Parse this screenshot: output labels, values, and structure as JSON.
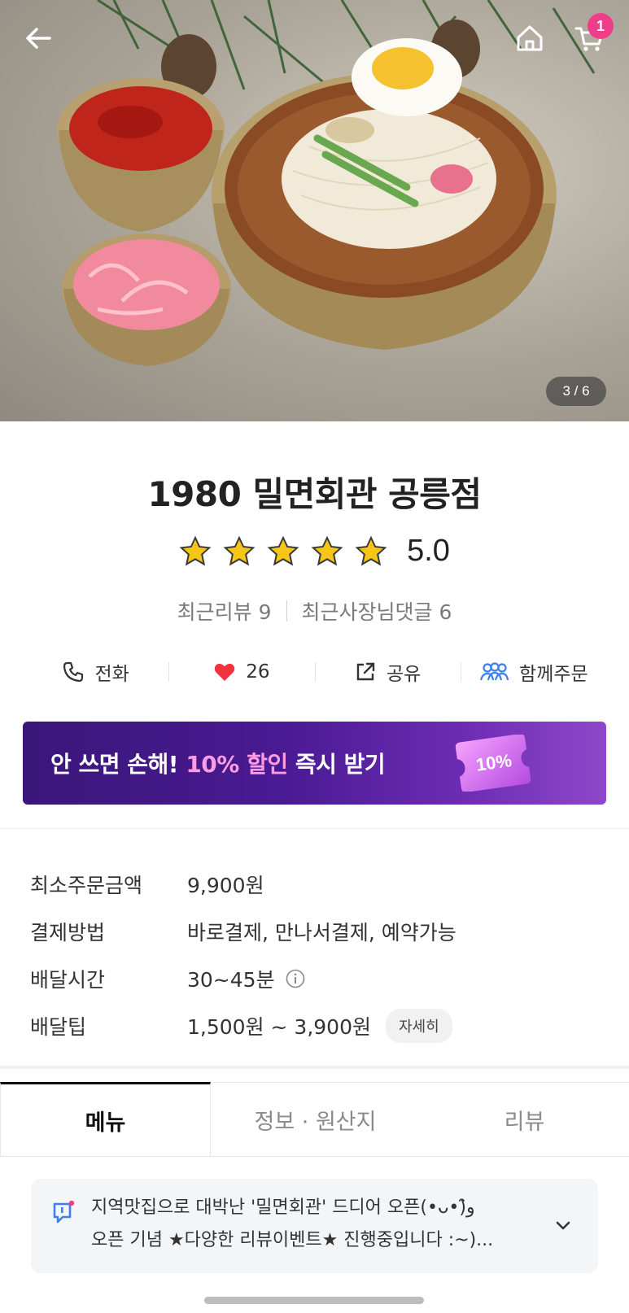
{
  "header": {
    "cart_count": "1",
    "image_pager": "3 / 6"
  },
  "store": {
    "name": "1980 밀면회관 공릉점",
    "rating": "5.0",
    "stars": 5,
    "recent_reviews": "최근리뷰 9",
    "owner_replies": "최근사장님댓글 6"
  },
  "actions": {
    "call": "전화",
    "likes": "26",
    "share": "공유",
    "group_order": "함께주문"
  },
  "banner": {
    "prefix": "안 쓰면 손해! ",
    "highlight": "10% 할인",
    "suffix": " 즉시 받기",
    "ticket": "10%"
  },
  "info": {
    "min_order_label": "최소주문금액",
    "min_order_value": "9,900원",
    "payment_label": "결제방법",
    "payment_value": "바로결제, 만나서결제, 예약가능",
    "delivery_time_label": "배달시간",
    "delivery_time_value": "30~45분",
    "delivery_tip_label": "배달팁",
    "delivery_tip_value": "1,500원 ~ 3,900원",
    "detail_button": "자세히"
  },
  "tabs": [
    "메뉴",
    "정보 · 원산지",
    "리뷰"
  ],
  "notice": {
    "line1": "지역맛집으로 대박난 '밀면회관' 드디어 오픈(•ᴗ•)و̑̑",
    "line2": "오픈 기념 ★다양한 리뷰이벤트★ 진행중입니다 :~)..."
  },
  "colors": {
    "accent_pink": "#f03d8a",
    "banner_purple": "#4a1a93",
    "star_yellow": "#f5c518",
    "heart_red": "#f0333d",
    "group_blue": "#3d7ff0"
  },
  "icons": [
    "back-arrow-icon",
    "home-icon",
    "cart-icon",
    "phone-icon",
    "heart-icon",
    "share-icon",
    "group-icon",
    "info-icon",
    "notice-icon",
    "chevron-down-icon"
  ]
}
